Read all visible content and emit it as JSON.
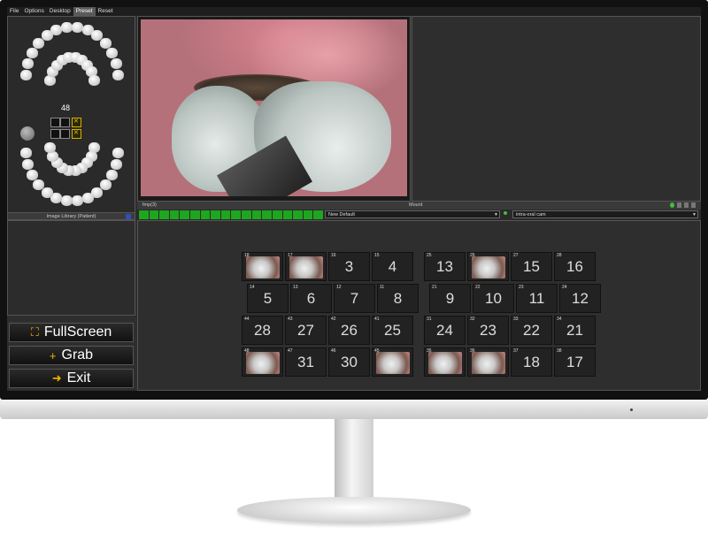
{
  "menu": [
    {
      "label": "File",
      "active": false
    },
    {
      "label": "Options",
      "active": false
    },
    {
      "label": "Desktop",
      "active": false
    },
    {
      "label": "Preset",
      "active": true
    },
    {
      "label": "Reset",
      "active": false
    }
  ],
  "tooth_selector": {
    "selected_number": "48"
  },
  "library": {
    "header": "Image Library (Patient)"
  },
  "buttons": {
    "fullscreen": "FullScreen",
    "grab": "Grab",
    "exit": "Exit"
  },
  "toolbar": {
    "left_label": "fmp(3)",
    "center_label": "Mount"
  },
  "progress": {
    "segments": 18
  },
  "selects": {
    "preset": "New Default",
    "camera": "intra-oral cam"
  },
  "grid": {
    "rows": [
      [
        {
          "id": "18",
          "label": "",
          "thumb": true
        },
        {
          "id": "17",
          "label": "",
          "thumb": true
        },
        {
          "id": "16",
          "label": "3",
          "thumb": false
        },
        {
          "id": "15",
          "label": "4",
          "thumb": false
        },
        {
          "id": "25",
          "label": "13",
          "thumb": false
        },
        {
          "id": "26",
          "label": "",
          "thumb": true
        },
        {
          "id": "27",
          "label": "15",
          "thumb": false
        },
        {
          "id": "28",
          "label": "16",
          "thumb": false
        }
      ],
      [
        {
          "id": "14",
          "label": "5",
          "thumb": false
        },
        {
          "id": "13",
          "label": "6",
          "thumb": false
        },
        {
          "id": "12",
          "label": "7",
          "thumb": false
        },
        {
          "id": "11",
          "label": "8",
          "thumb": false
        },
        {
          "id": "21",
          "label": "9",
          "thumb": false
        },
        {
          "id": "22",
          "label": "10",
          "thumb": false
        },
        {
          "id": "23",
          "label": "11",
          "thumb": false
        },
        {
          "id": "24",
          "label": "12",
          "thumb": false
        }
      ],
      [
        {
          "id": "44",
          "label": "28",
          "thumb": false
        },
        {
          "id": "43",
          "label": "27",
          "thumb": false
        },
        {
          "id": "42",
          "label": "26",
          "thumb": false
        },
        {
          "id": "41",
          "label": "25",
          "thumb": false
        },
        {
          "id": "31",
          "label": "24",
          "thumb": false
        },
        {
          "id": "32",
          "label": "23",
          "thumb": false
        },
        {
          "id": "33",
          "label": "22",
          "thumb": false
        },
        {
          "id": "34",
          "label": "21",
          "thumb": false
        }
      ],
      [
        {
          "id": "48",
          "label": "",
          "thumb": true
        },
        {
          "id": "47",
          "label": "31",
          "thumb": false
        },
        {
          "id": "46",
          "label": "30",
          "thumb": false
        },
        {
          "id": "45",
          "label": "",
          "thumb": true
        },
        {
          "id": "35",
          "label": "",
          "thumb": true
        },
        {
          "id": "36",
          "label": "",
          "thumb": true
        },
        {
          "id": "37",
          "label": "18",
          "thumb": false
        },
        {
          "id": "38",
          "label": "17",
          "thumb": false
        }
      ]
    ]
  }
}
